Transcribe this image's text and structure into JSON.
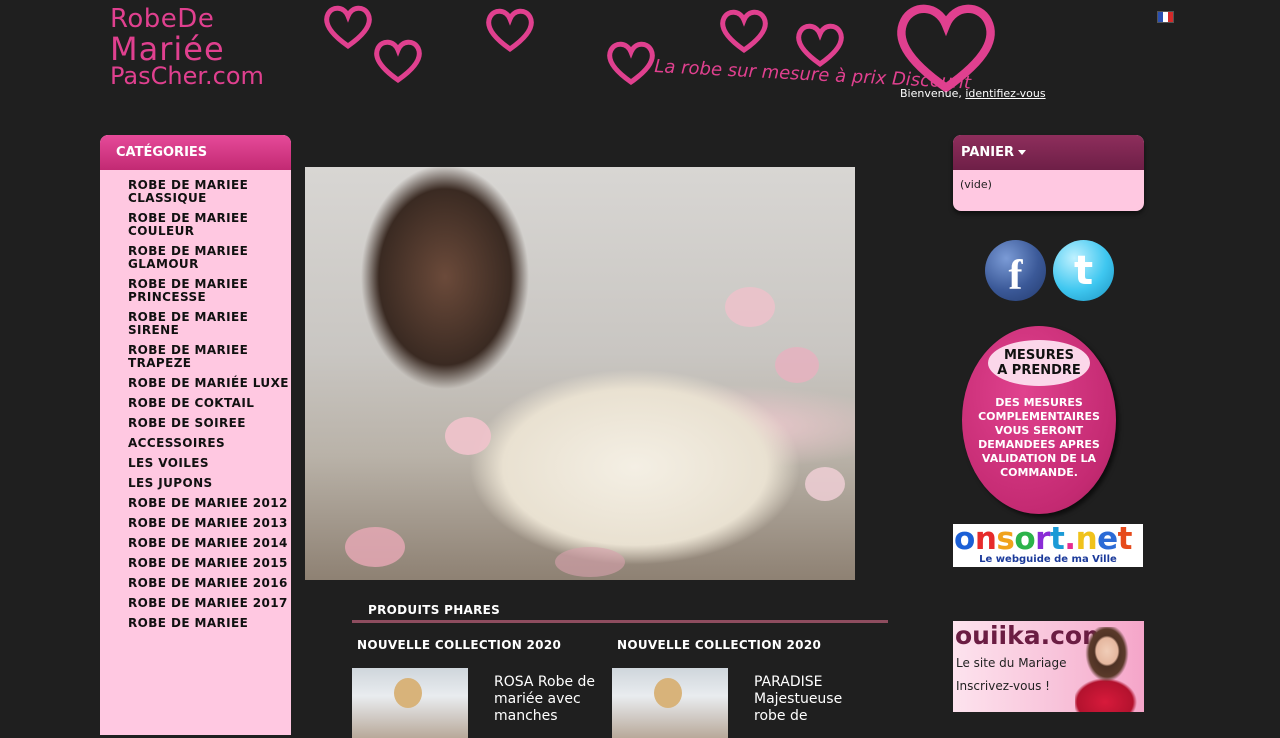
{
  "header": {
    "logo_line1": "RobeDe",
    "logo_line2": "Mariée",
    "logo_line3": "PasCher.com",
    "tagline": "La robe sur mesure à prix Discount",
    "welcome_text": "Bienvenue,",
    "login_link": "identifiez-vous",
    "flag_icon": "flag-fr-icon",
    "brand_color": "#e0408f"
  },
  "categories": {
    "title": "CATÉGORIES",
    "items": [
      "ROBE DE MARIEE CLASSIQUE",
      "ROBE DE MARIEE COULEUR",
      "ROBE DE MARIEE GLAMOUR",
      "ROBE DE MARIEE PRINCESSE",
      "ROBE DE MARIEE SIRENE",
      "ROBE DE MARIEE TRAPEZE",
      "ROBE DE MARIÉE LUXE",
      "ROBE DE COKTAIL",
      "ROBE DE SOIREE",
      "ACCESSOIRES",
      "LES VOILES",
      "LES JUPONS",
      "ROBE DE MARIEE 2012",
      "ROBE DE MARIEE 2013",
      "ROBE DE MARIEE 2014",
      "ROBE DE MARIEE 2015",
      "ROBE DE MARIEE 2016",
      "ROBE DE MARIEE 2017",
      "ROBE DE MARIEE"
    ]
  },
  "featured": {
    "title": "PRODUITS PHARES",
    "products": [
      {
        "collection": "NOUVELLE COLLECTION 2020",
        "name": "ROSA Robe de mariée avec manches"
      },
      {
        "collection": "NOUVELLE COLLECTION 2020",
        "name": "PARADISE Majestueuse robe de"
      }
    ]
  },
  "cart": {
    "title": "PANIER",
    "status": "(vide)"
  },
  "social": {
    "facebook_glyph": "f",
    "twitter_glyph": "t"
  },
  "mesures": {
    "bubble_line1": "MESURES",
    "bubble_line2": "A PRENDRE",
    "text": "DES MESURES COMPLEMENTAIRES VOUS SERONT DEMANDEES APRES VALIDATION DE LA COMMANDE."
  },
  "ads": {
    "onsort_name": "onsort.net",
    "onsort_sub": "Le webguide de ma Ville",
    "ouiika_name": "ouiika.com",
    "ouiika_line1": "Le site du Mariage",
    "ouiika_line2": "Inscrivez-vous !"
  }
}
